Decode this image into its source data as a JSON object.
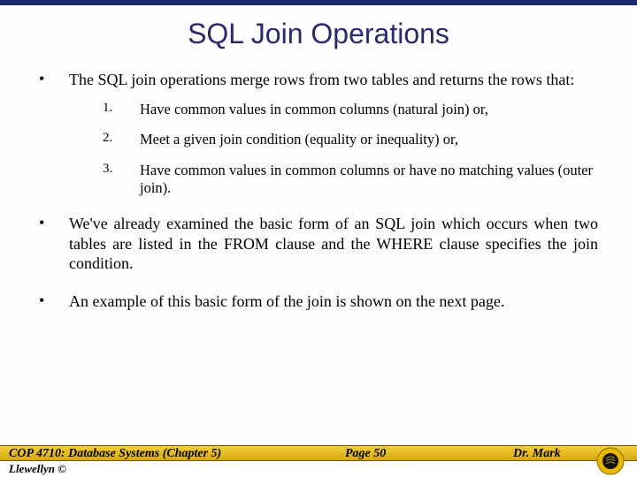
{
  "title": "SQL Join Operations",
  "bullets": {
    "b1": "The SQL join operations merge rows from two tables and returns the rows that:",
    "b2": "We've already examined the basic form of an SQL join which occurs when two tables are listed in the FROM clause and the WHERE clause specifies the join condition.",
    "b3": "An example of this basic form of the join is shown on the next page."
  },
  "numlist": {
    "n1": {
      "num": "1.",
      "text": "Have common values in common columns (natural join) or,"
    },
    "n2": {
      "num": "2.",
      "text": "Meet a given join condition (equality or inequality) or,"
    },
    "n3": {
      "num": "3.",
      "text": "Have common values in common columns or have no matching values (outer join)."
    }
  },
  "footer": {
    "left": "COP 4710: Database Systems  (Chapter 5)",
    "mid": "Page 50",
    "right": "Dr. Mark",
    "below": "Llewellyn ©"
  }
}
